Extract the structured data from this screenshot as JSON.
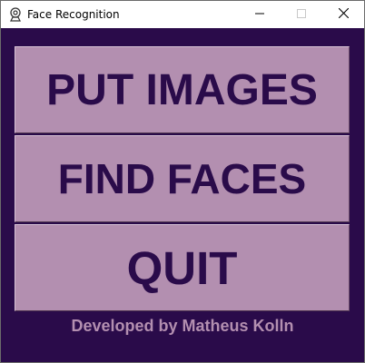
{
  "window": {
    "title": "Face Recognition",
    "icon": "webcam-icon",
    "controls": [
      "minimize-icon",
      "maximize-icon",
      "close-icon"
    ]
  },
  "buttons": [
    {
      "label": "PUT IMAGES"
    },
    {
      "label": "FIND FACES"
    },
    {
      "label": "QUIT"
    }
  ],
  "footer": {
    "credit": "Developed by Matheus Kolln"
  },
  "colors": {
    "background": "#2a0b4a",
    "button": "#b38fb0",
    "button_text": "#2a0b4a",
    "footer_text": "#b38fb0"
  }
}
